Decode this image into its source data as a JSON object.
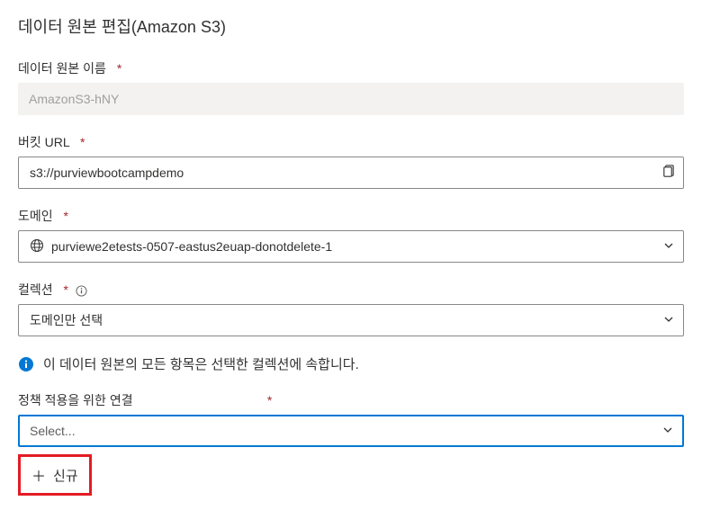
{
  "title": "데이터 원본 편집(Amazon S3)",
  "fields": {
    "dataSourceName": {
      "label": "데이터 원본 이름",
      "value": "AmazonS3-hNY"
    },
    "bucketUrl": {
      "label": "버킷 URL",
      "value": "s3://purviewbootcampdemo"
    },
    "domain": {
      "label": "도메인",
      "value": "purviewe2etests-0507-eastus2euap-donotdelete-1"
    },
    "collection": {
      "label": "컬렉션",
      "value": "도메인만 선택"
    },
    "policyConnection": {
      "label": "정책 적용을 위한 연결",
      "placeholder": "Select..."
    }
  },
  "infoMessage": "이 데이터 원본의 모든 항목은 선택한 컬렉션에 속합니다.",
  "newButtonLabel": "신규",
  "requiredMark": "*"
}
